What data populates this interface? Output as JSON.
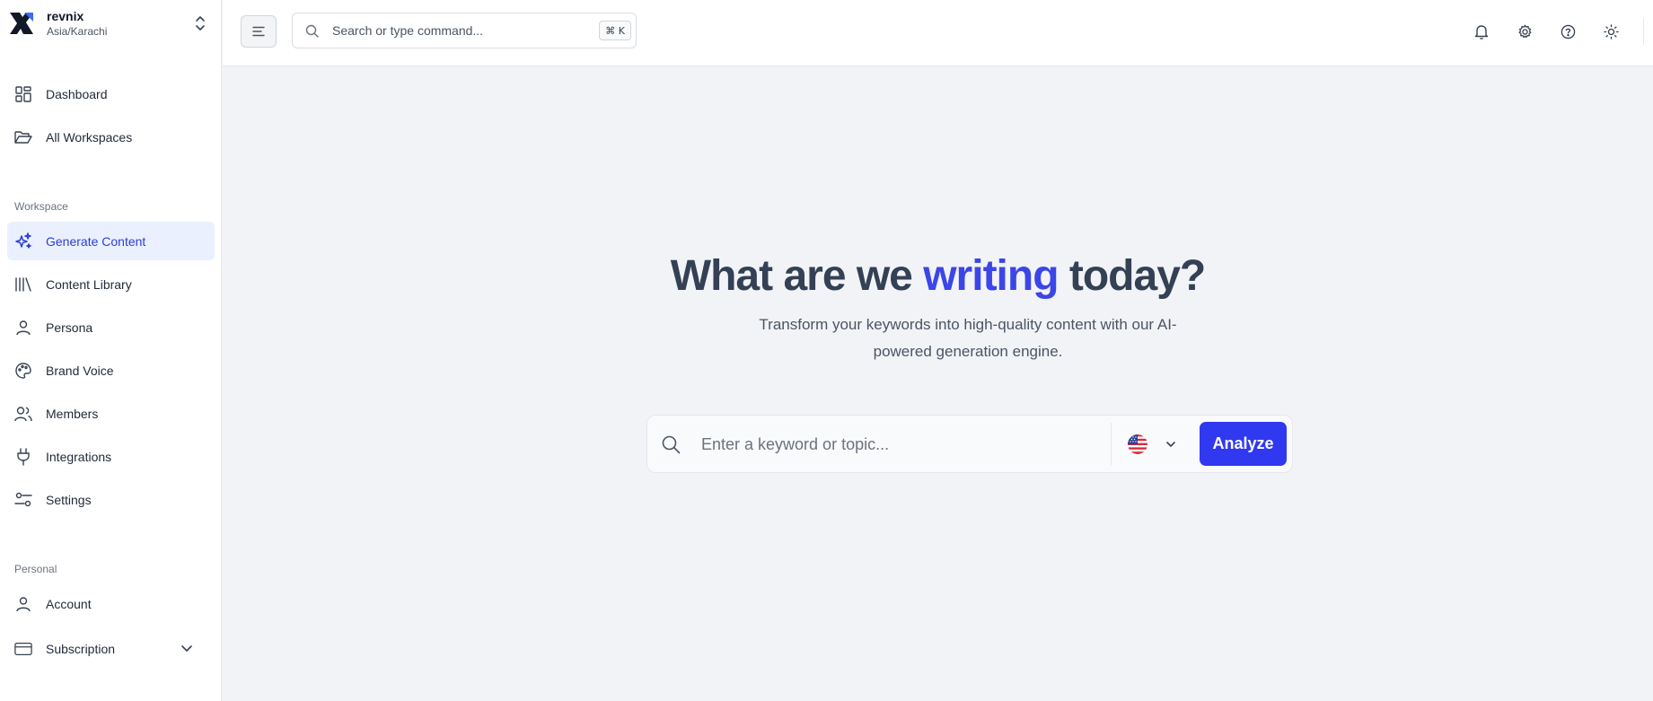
{
  "brand": {
    "name": "revnix",
    "timezone": "Asia/Karachi"
  },
  "nav": {
    "main": [
      {
        "label": "Dashboard",
        "icon": "dashboard-icon"
      },
      {
        "label": "All Workspaces",
        "icon": "folder-open-icon"
      }
    ],
    "workspace_label": "Workspace",
    "workspace": [
      {
        "label": "Generate Content",
        "icon": "sparkles-icon",
        "active": true
      },
      {
        "label": "Content Library",
        "icon": "library-icon"
      },
      {
        "label": "Persona",
        "icon": "user-icon"
      },
      {
        "label": "Brand Voice",
        "icon": "palette-icon"
      },
      {
        "label": "Members",
        "icon": "users-icon"
      },
      {
        "label": "Integrations",
        "icon": "plug-icon"
      },
      {
        "label": "Settings",
        "icon": "sliders-icon"
      }
    ],
    "personal_label": "Personal",
    "personal": [
      {
        "label": "Account",
        "icon": "user-icon"
      },
      {
        "label": "Subscription",
        "icon": "credit-card-icon"
      }
    ]
  },
  "topbar": {
    "search_placeholder": "Search or type command...",
    "shortcut": "⌘ K",
    "icons": [
      "bell-icon",
      "gear-icon",
      "help-icon",
      "sun-icon"
    ]
  },
  "hero": {
    "title_pre": "What are we ",
    "title_accent": "writing",
    "title_post": " today?",
    "subtitle": "Transform your keywords into high-quality content with our AI-powered generation engine."
  },
  "keyword": {
    "placeholder": "Enter a keyword or topic...",
    "value": "",
    "country": "US",
    "button": "Analyze"
  },
  "colors": {
    "accent": "#3b45e8",
    "button": "#3039ef",
    "active_bg": "#eaf0fd"
  }
}
